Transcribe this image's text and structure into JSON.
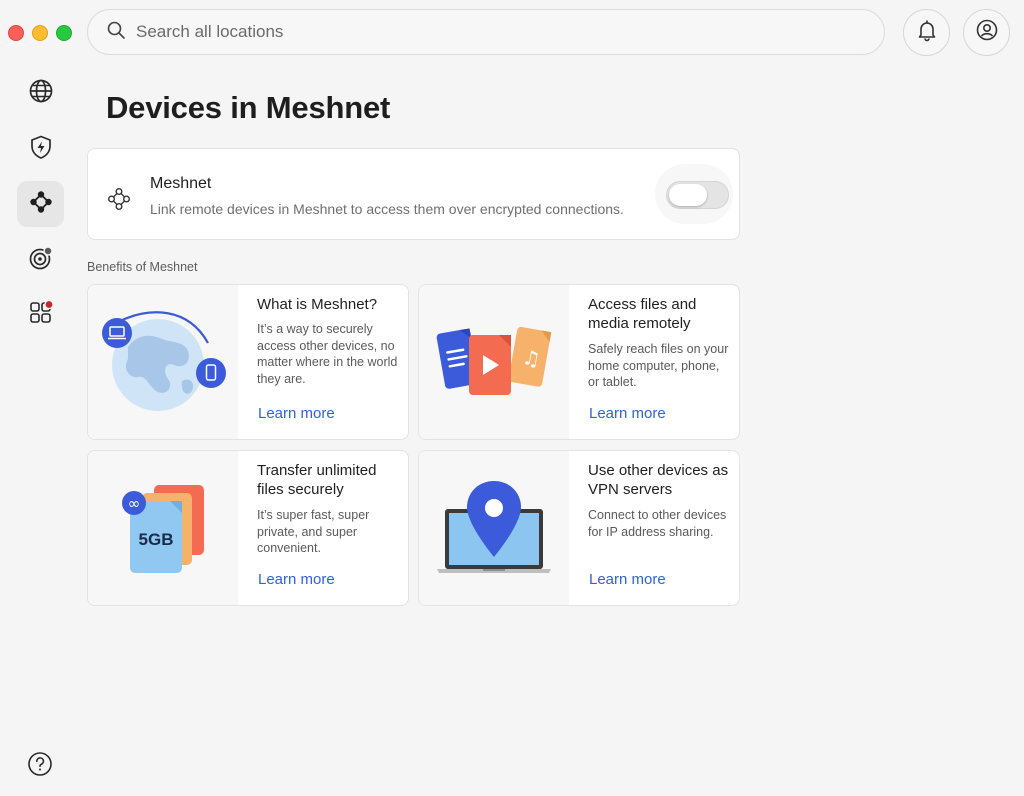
{
  "window": {
    "controls": [
      "close",
      "minimize",
      "zoom"
    ]
  },
  "search": {
    "placeholder": "Search all locations"
  },
  "header": {
    "notifications_icon": "bell-icon",
    "account_icon": "account-icon"
  },
  "sidebar": {
    "items": [
      {
        "name": "globe",
        "icon": "globe-icon",
        "active": false
      },
      {
        "name": "threat-protection",
        "icon": "shield-bolt-icon",
        "active": false
      },
      {
        "name": "meshnet",
        "icon": "meshnet-icon",
        "active": true
      },
      {
        "name": "dark-web-monitor",
        "icon": "radar-icon",
        "active": false,
        "badge_color": "#5a5a5a"
      },
      {
        "name": "apps",
        "icon": "apps-grid-icon",
        "active": false,
        "badge_color": "#c62828"
      }
    ],
    "help_icon": "help-icon"
  },
  "page": {
    "title": "Devices in Meshnet"
  },
  "meshnet": {
    "title": "Meshnet",
    "description": "Link remote devices in Meshnet to access them over encrypted connections.",
    "enabled": false
  },
  "benefits": {
    "label": "Benefits of Meshnet",
    "cards": [
      {
        "title": "What is Meshnet?",
        "description": "It’s a way to securely access other devices, no matter where in the world they are.",
        "link": "Learn more"
      },
      {
        "title": "Access files and media remotely",
        "description": "Safely reach files on your home computer, phone, or tablet.",
        "link": "Learn more"
      },
      {
        "title": "Transfer unlimited files securely",
        "description": "It’s super fast, super private, and super convenient.",
        "link": "Learn more",
        "illustration_text": "5GB"
      },
      {
        "title": "Use other devices as VPN servers",
        "description": "Connect to other devices for IP address sharing.",
        "link": "Learn more"
      }
    ]
  },
  "colors": {
    "accent": "#2f62de",
    "link": "#2f62de",
    "icon_blue": "#3b5bdb"
  }
}
